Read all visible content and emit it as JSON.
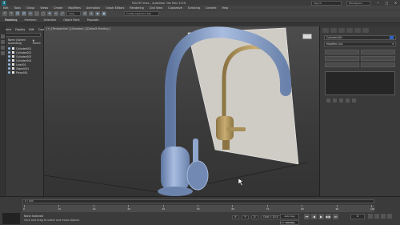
{
  "window": {
    "title": "FAUCET.max - Autodesk 3ds Max 2016",
    "sign_in": "Sign In",
    "workspace": "Workspace: Default",
    "controls": [
      "─",
      "□",
      "✕"
    ]
  },
  "menu": [
    "Edit",
    "Tools",
    "Group",
    "Views",
    "Create",
    "Modifiers",
    "Animation",
    "Graph Editors",
    "Rendering",
    "Civil View",
    "Customize",
    "Scripting",
    "Content",
    "Help"
  ],
  "toolbar": {
    "icons": [
      "↶",
      "↷",
      "⛓",
      "⛓",
      "≋",
      "⬚",
      "⬚",
      "✥",
      "⟲",
      "⤢",
      "⊞",
      "⊕",
      "◉",
      "▣"
    ],
    "selection_set": "Create Selection Set",
    "view_dropdown": "View"
  },
  "ribbon": {
    "tabs": [
      "Modeling",
      "Freeform",
      "Selection",
      "Object Paint",
      "Populate"
    ],
    "active_index": 0
  },
  "scene_explorer": {
    "tabs": [
      "Select",
      "Display",
      "Edit",
      "Customize"
    ],
    "header": "Name (Sorted Ascending)",
    "sort_hint": "▲ Frozen",
    "items": [
      "Cylinder001",
      "Cylinder002",
      "Cylinder003",
      "Cylinder004",
      "Line001",
      "Object001",
      "Plane001"
    ]
  },
  "viewport": {
    "label": "[+] [Perspective ] [Standard ] [Default Shading ]",
    "background": "#4a4a4a",
    "faucet_color": "#8aa2c8",
    "ref_faucet_color": "#a08a55",
    "plane_color": "#cfccc6"
  },
  "command_panel": {
    "object_name": "Cylinder001",
    "modifier_list": "Modifier List",
    "color_swatch": "#2f63c8"
  },
  "timeline": {
    "slider_label": "0 / 100",
    "ticks": [
      "0",
      "10",
      "20",
      "30",
      "40",
      "50",
      "60",
      "70",
      "80",
      "90",
      "100"
    ]
  },
  "status": {
    "selection": "None Selected",
    "prompt": "Click and drag to select and move objects",
    "grid": "Grid = 10.0",
    "x": "X:",
    "y": "Y:",
    "z": "Z:",
    "auto_key": "Auto Key",
    "set_key": "Set Key",
    "frame": "0",
    "add_time_tag": "Add Time Tag",
    "playback": [
      "⏮",
      "◀",
      "▶",
      "▶▶",
      "⏭"
    ]
  }
}
